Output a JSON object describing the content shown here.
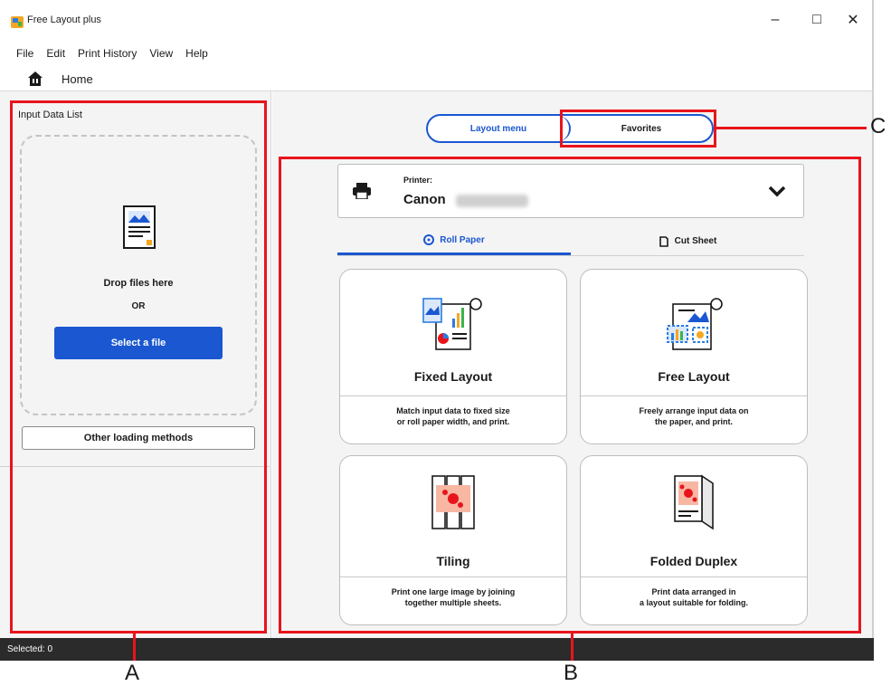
{
  "window": {
    "title": "Free Layout plus",
    "controls": {
      "minimize": "–",
      "maximize": "□",
      "close": "✕"
    }
  },
  "menu": [
    "File",
    "Edit",
    "Print History",
    "View",
    "Help"
  ],
  "home": {
    "label": "Home",
    "icon": "home-icon"
  },
  "input_panel": {
    "title": "Input Data List",
    "drop_text": "Drop files here",
    "or_text": "OR",
    "select_button": "Select a file",
    "other_button": "Other loading methods"
  },
  "menu_tabs": {
    "layout": "Layout menu",
    "favorites": "Favorites"
  },
  "printer": {
    "caption": "Printer:",
    "name": "Canon"
  },
  "paper_tabs": {
    "roll": "Roll Paper",
    "cut": "Cut Sheet"
  },
  "cards": [
    {
      "title": "Fixed Layout",
      "desc_line1": "Match input data to fixed size",
      "desc_line2": "or roll paper width, and print."
    },
    {
      "title": "Free Layout",
      "desc_line1": "Freely arrange input data on",
      "desc_line2": "the paper, and print."
    },
    {
      "title": "Tiling",
      "desc_line1": "Print one large image by joining",
      "desc_line2": "together multiple sheets."
    },
    {
      "title": "Folded Duplex",
      "desc_line1": "Print data arranged in",
      "desc_line2": "a layout suitable for folding."
    }
  ],
  "status": {
    "selected": "Selected: 0"
  },
  "callouts": {
    "a": "A",
    "b": "B",
    "c": "C"
  },
  "colors": {
    "accent": "#1a57d0",
    "callout": "#e8141c",
    "statusbar": "#2b2b2b"
  }
}
